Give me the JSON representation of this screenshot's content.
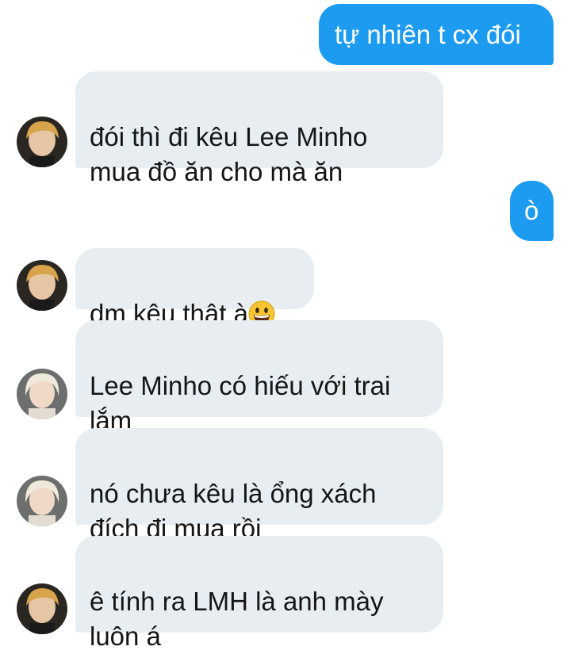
{
  "messages": [
    {
      "side": "sent",
      "text": "tự nhiên t cx đói"
    },
    {
      "side": "received",
      "text": "đói thì đi kêu Lee Minho\nmua đồ ăn cho mà ăn",
      "avatar": "user-a-avatar"
    },
    {
      "side": "sent",
      "text": "ò"
    },
    {
      "side": "received",
      "text": "dm kêu thật à",
      "emoji": "grinning-face-emoji",
      "avatar": "user-a-avatar"
    },
    {
      "side": "received",
      "text": "Lee Minho có hiếu với trai\nlắm",
      "avatar": "user-b-avatar"
    },
    {
      "side": "received",
      "text": "nó chưa kêu là ổng xách\nđích đi mua rồi",
      "avatar": "user-b-avatar"
    },
    {
      "side": "received",
      "text": "ê tính ra LMH là anh mày\nluôn á",
      "avatar": "user-a-avatar"
    }
  ],
  "colors": {
    "sent_bubble": "#1d9bf0",
    "received_bubble": "#e8edf1",
    "sent_text": "#ffffff",
    "received_text": "#151515"
  }
}
